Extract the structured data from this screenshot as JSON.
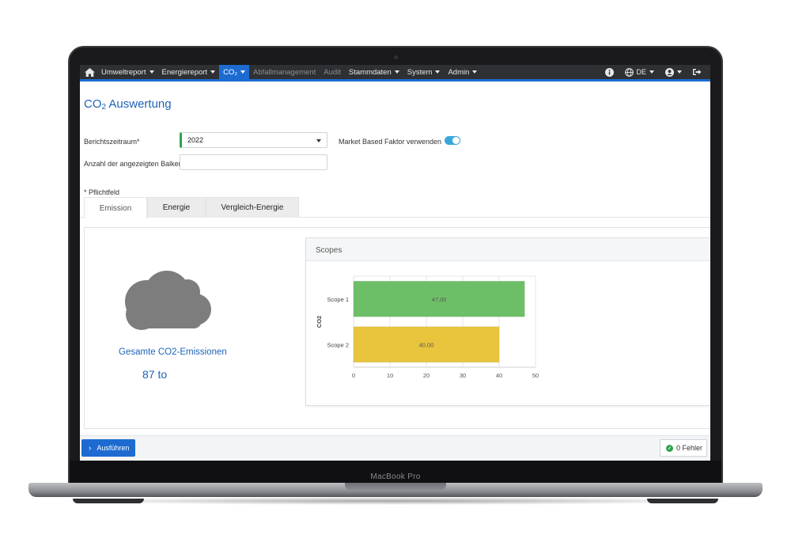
{
  "device": {
    "label": "MacBook Pro"
  },
  "navbar": {
    "items": [
      {
        "label": "Umweltreport"
      },
      {
        "label": "Energiereport"
      },
      {
        "label": "CO₂"
      },
      {
        "label": "Abfallmanagement"
      },
      {
        "label": "Audit"
      },
      {
        "label": "Stammdaten"
      },
      {
        "label": "System"
      },
      {
        "label": "Admin"
      }
    ],
    "language": "DE",
    "colors": {
      "bar": "#2f3033",
      "accent": "#1d6bd1"
    }
  },
  "page": {
    "title_main": "CO",
    "title_sub": "2",
    "title_rest": " Auswertung"
  },
  "form": {
    "period_label": "Berichtszeitraum*",
    "period_value": "2022",
    "bars_label": "Anzahl der angezeigten Balken",
    "bars_value": "",
    "market_label": "Market Based Faktor verwenden",
    "market_enabled": true,
    "required_note": "* Pflichtfeld"
  },
  "tabs": [
    {
      "label": "Emission"
    },
    {
      "label": "Energie"
    },
    {
      "label": "Vergleich-Energie"
    }
  ],
  "emission": {
    "label": "Gesamte CO2-Emissionen",
    "value": "87 to",
    "icon": "cloud-icon"
  },
  "chart_title": "Scopes",
  "chart_data": {
    "type": "bar",
    "orientation": "horizontal",
    "categories": [
      "Scope 1",
      "Scope 2"
    ],
    "values": [
      47,
      40
    ],
    "value_labels": [
      "47,00",
      "40,00"
    ],
    "colors": [
      "#6dbf67",
      "#e9c53d"
    ],
    "ylabel": "CO2",
    "xlabel": "",
    "xlim": [
      0,
      50
    ],
    "xticks": [
      0,
      10,
      20,
      30,
      40,
      50
    ],
    "grid": true
  },
  "footer": {
    "run_label": "Ausführen",
    "errors_label": "0 Fehler"
  }
}
